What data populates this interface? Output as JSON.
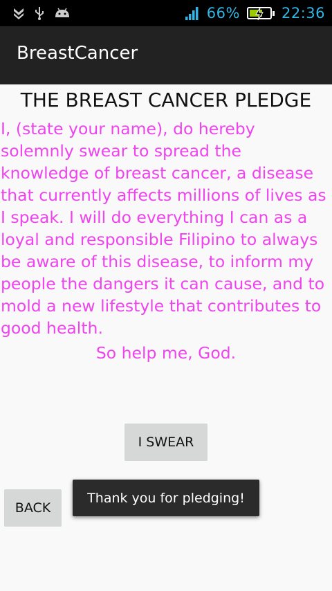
{
  "status_bar": {
    "icons_left": [
      "download-icon",
      "usb-icon",
      "android-icon"
    ],
    "signal_icon": "signal-icon",
    "battery_percent": "66%",
    "battery_level": 0.66,
    "time": "22:36",
    "accent_color": "#33b5e5"
  },
  "action_bar": {
    "title": "BreastCancer"
  },
  "pledge": {
    "title": "THE BREAST CANCER PLEDGE",
    "body": "I, (state your name), do hereby solemnly swear to spread the knowledge of breast cancer, a disease that currently affects millions of lives as I speak. I will do everything I can as a loyal and responsible Filipino to always be aware of this disease, to inform my people the dangers it can cause, and to mold a new lifestyle that contributes to good health.",
    "closing": "So help me, God.",
    "text_color": "#ee44ee"
  },
  "buttons": {
    "swear_label": "I SWEAR",
    "back_label": "BACK"
  },
  "toast": {
    "message": "Thank you for pledging!"
  }
}
